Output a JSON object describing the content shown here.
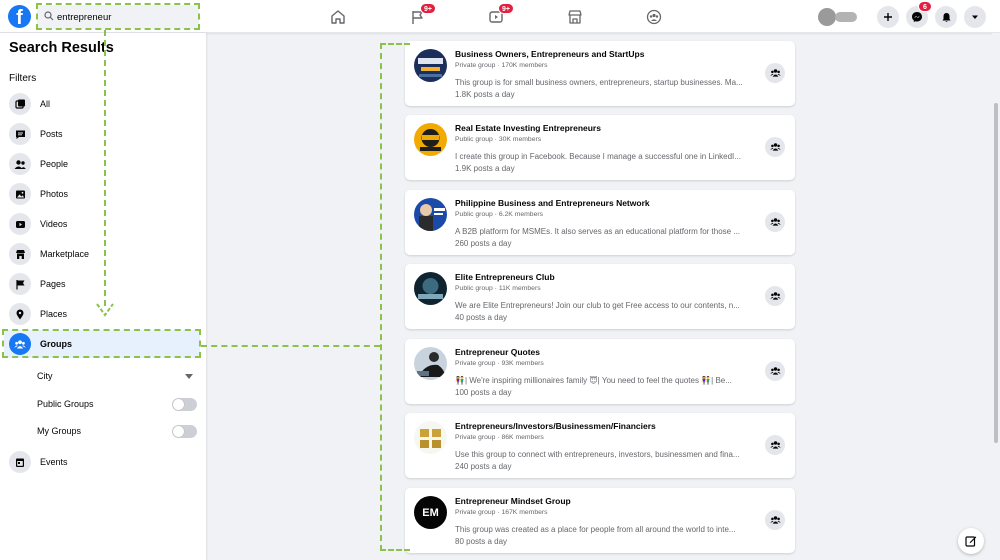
{
  "search": {
    "value": "entrepreneur"
  },
  "nav": {
    "pages_badge": "9+",
    "watch_badge": "9+"
  },
  "header": {
    "messenger_badge": "6"
  },
  "sidebar": {
    "title": "Search Results",
    "filters_label": "Filters",
    "items": [
      {
        "label": "All",
        "icon": "all-icon"
      },
      {
        "label": "Posts",
        "icon": "posts-icon"
      },
      {
        "label": "People",
        "icon": "people-icon"
      },
      {
        "label": "Photos",
        "icon": "photos-icon"
      },
      {
        "label": "Videos",
        "icon": "videos-icon"
      },
      {
        "label": "Marketplace",
        "icon": "marketplace-icon"
      },
      {
        "label": "Pages",
        "icon": "flag-icon"
      },
      {
        "label": "Places",
        "icon": "pin-icon"
      },
      {
        "label": "Groups",
        "icon": "groups-icon"
      },
      {
        "label": "Events",
        "icon": "calendar-icon"
      }
    ],
    "groups_filters": {
      "city": "City",
      "public_groups": "Public Groups",
      "my_groups": "My Groups"
    }
  },
  "results": [
    {
      "title": "Business Owners, Entrepreneurs and StartUps",
      "meta": "Private group · 170K members",
      "desc": "This group is for small business owners, entrepreneurs, startup businesses. Ma...",
      "posts": "1.8K posts a day"
    },
    {
      "title": "Real Estate Investing Entrepreneurs",
      "meta": "Public group · 30K members",
      "desc": "I create this group in Facebook. Because I manage a successful one in LinkedI...",
      "posts": "1.9K posts a day"
    },
    {
      "title": "Philippine Business and Entrepreneurs Network",
      "meta": "Public group · 6.2K members",
      "desc": "A B2B platform for MSMEs. It also serves as an educational platform for those ...",
      "posts": "260 posts a day"
    },
    {
      "title": "Elite Entrepreneurs Club",
      "meta": "Public group · 11K members",
      "desc": "We are Elite Entrepreneurs! Join our club to get Free access to our contents, n...",
      "posts": "40 posts a day"
    },
    {
      "title": "Entrepreneur Quotes",
      "meta": "Private group · 93K members",
      "desc": "👫| We're inspiring millionaires family 😇| You need to feel the quotes 👫| Be...",
      "posts": "100 posts a day"
    },
    {
      "title": "Entrepreneurs/Investors/Businessmen/Financiers",
      "meta": "Private group · 86K members",
      "desc": "Use this group to connect with entrepreneurs, investors, businessmen and fina...",
      "posts": "240 posts a day"
    },
    {
      "title": "Entrepreneur Mindset Group",
      "meta": "Private group · 167K members",
      "desc": "This group was created as a place for people from all around the world to inte...",
      "posts": "80 posts a day"
    }
  ],
  "thumb_logo_text": "EM",
  "colors": {
    "brand": "#1877f2",
    "badge": "#e41e3f",
    "annotation": "#8bc34a"
  }
}
